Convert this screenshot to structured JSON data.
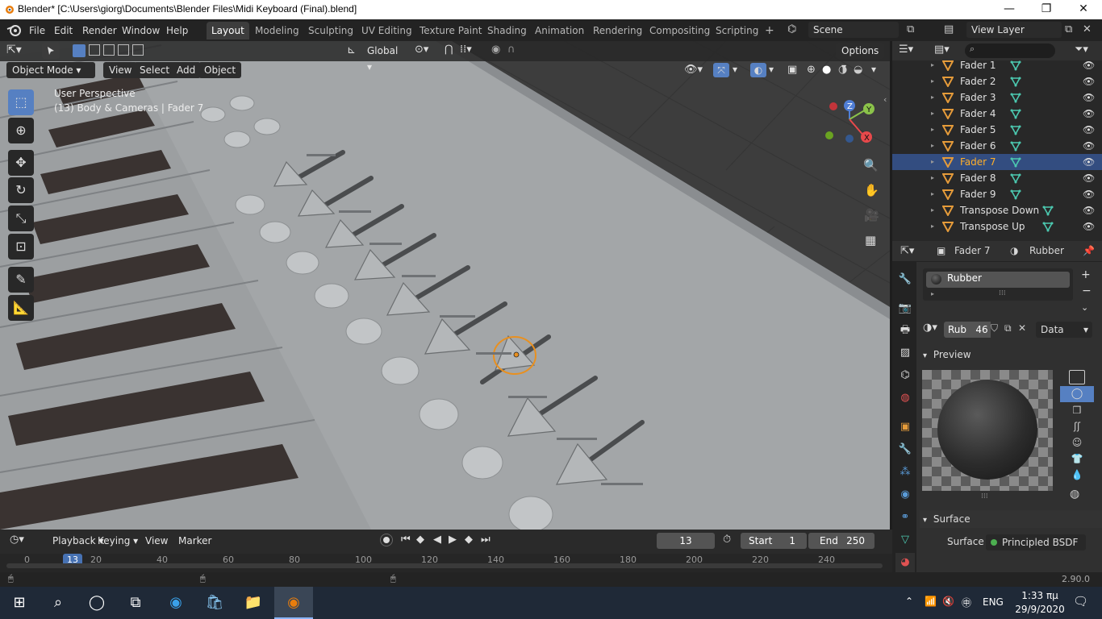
{
  "window": {
    "title": "Blender* [C:\\Users\\giorg\\Documents\\Blender Files\\Midi Keyboard (Final).blend]",
    "minimize": "—",
    "restore": "❐",
    "close": "✕"
  },
  "menu": [
    "File",
    "Edit",
    "Render",
    "Window",
    "Help"
  ],
  "workspaces": [
    "Layout",
    "Modeling",
    "Sculpting",
    "UV Editing",
    "Texture Paint",
    "Shading",
    "Animation",
    "Rendering",
    "Compositing",
    "Scripting"
  ],
  "add_workspace": "+",
  "scene": "Scene",
  "view_layer": "View Layer",
  "toolbar": {
    "orientation": "Global",
    "options": "Options"
  },
  "viewport": {
    "mode": "Object Mode",
    "view_menu": "View",
    "select_menu": "Select",
    "add_menu": "Add",
    "object_menu": "Object",
    "perspective": "User Perspective",
    "context": "(13) Body & Cameras | Fader 7",
    "axis_x": "X",
    "axis_y": "Y",
    "axis_z": "Z"
  },
  "outliner": {
    "search_placeholder": "",
    "items": [
      {
        "name": "Fader 1",
        "selected": false
      },
      {
        "name": "Fader 2",
        "selected": false
      },
      {
        "name": "Fader 3",
        "selected": false
      },
      {
        "name": "Fader 4",
        "selected": false
      },
      {
        "name": "Fader 5",
        "selected": false
      },
      {
        "name": "Fader 6",
        "selected": false
      },
      {
        "name": "Fader 7",
        "selected": true
      },
      {
        "name": "Fader 8",
        "selected": false
      },
      {
        "name": "Fader 9",
        "selected": false
      },
      {
        "name": "Transpose Down",
        "selected": false
      },
      {
        "name": "Transpose Up",
        "selected": false
      }
    ]
  },
  "properties": {
    "object": "Fader 7",
    "material": "Rubber",
    "slot": "Rubber",
    "mat_short": "Rub",
    "users": "46",
    "link": "Data",
    "preview_label": "Preview",
    "surface_panel": "Surface",
    "surface_label": "Surface",
    "surface_value": "Principled BSDF"
  },
  "timeline": {
    "playback": "Playback",
    "keying": "Keying",
    "view": "View",
    "marker": "Marker",
    "current_frame": "13",
    "start_label": "Start",
    "start": "1",
    "end_label": "End",
    "end": "250",
    "ticks": [
      "0",
      "20",
      "40",
      "60",
      "80",
      "100",
      "120",
      "140",
      "160",
      "180",
      "200",
      "220",
      "240"
    ],
    "frame_marker": "13"
  },
  "status": {
    "version": "2.90.0"
  },
  "taskbar": {
    "language": "ENG",
    "time": "1:33 πμ",
    "date": "29/9/2020"
  },
  "colors": {
    "accent": "#5680c2",
    "selected_text": "#ffaf29",
    "object_icon": "#e59b3a",
    "mesh_icon": "#4cc9b0"
  }
}
